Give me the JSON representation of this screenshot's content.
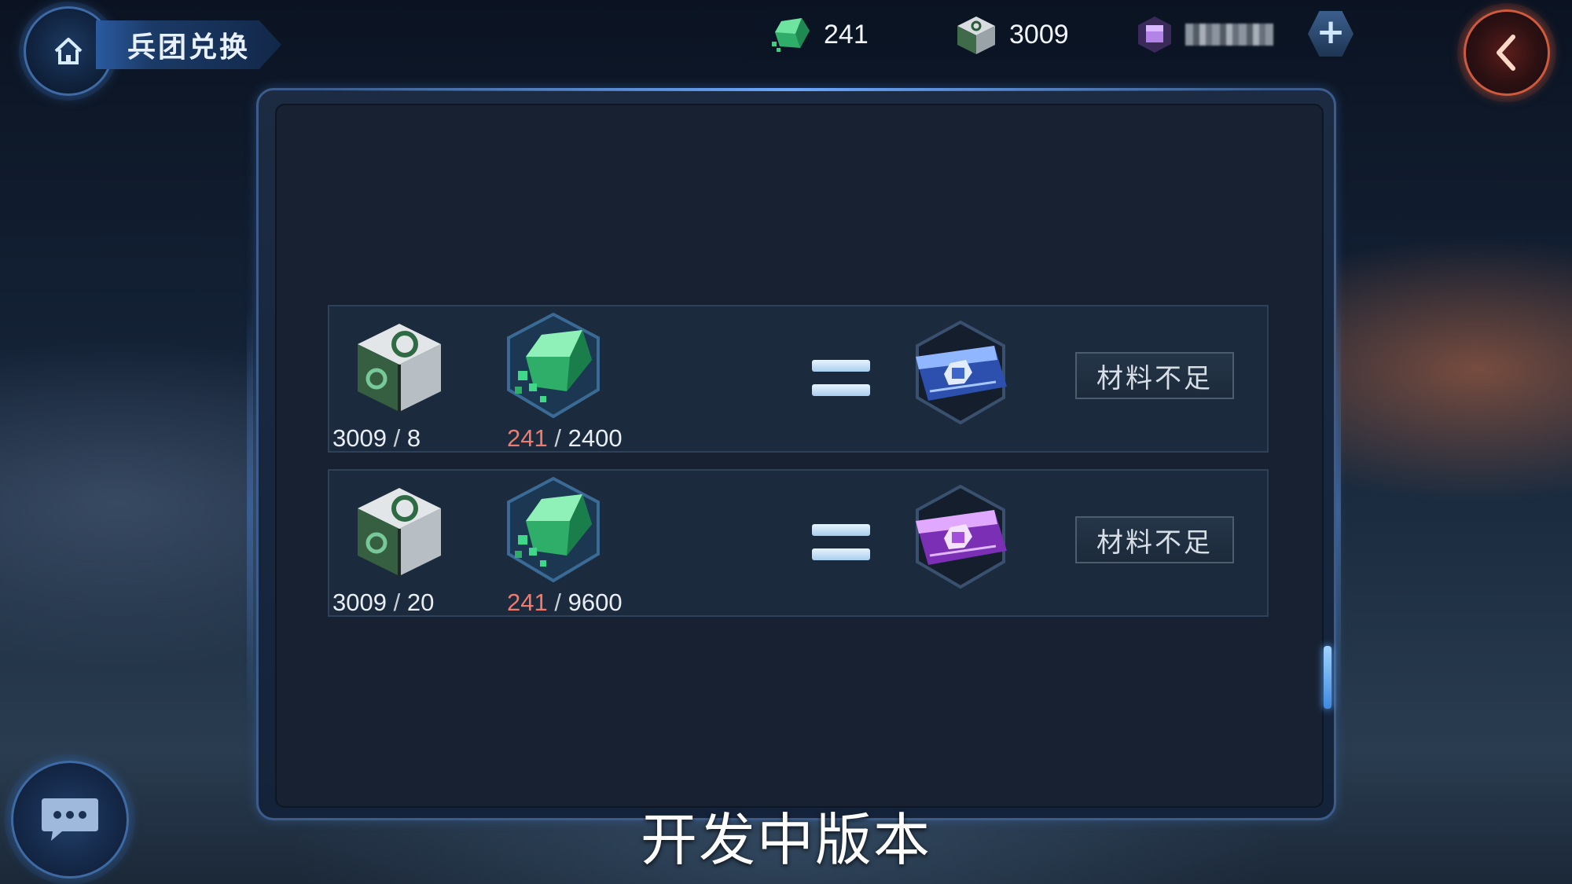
{
  "header": {
    "home_icon": "home-icon",
    "title": "兵团兑换",
    "back_icon": "chevron-left-icon"
  },
  "resources": {
    "green_crystal": {
      "icon": "green-crystal-icon",
      "value": "241"
    },
    "gray_cube": {
      "icon": "gray-cube-icon",
      "value": "3009"
    },
    "purple_currency": {
      "icon": "purple-gem-icon",
      "value": ""
    },
    "add_icon": "plus-icon"
  },
  "exchanges": [
    {
      "cube_count": {
        "have": "3009",
        "need": "8"
      },
      "crystal_count": {
        "have": "241",
        "need": "2400"
      },
      "reward_tier": "blue",
      "status": "材料不足"
    },
    {
      "cube_count": {
        "have": "3009",
        "need": "20"
      },
      "crystal_count": {
        "have": "241",
        "need": "9600"
      },
      "reward_tier": "purple",
      "status": "材料不足"
    }
  ],
  "separator": "/",
  "footer": {
    "chat_icon": "chat-bubble-icon",
    "watermark": "开发中版本"
  },
  "colors": {
    "insufficient": "#f07b6d",
    "blue_card": "#4f7fe0",
    "purple_card": "#b15de8",
    "back_accent": "#d05a3c"
  }
}
